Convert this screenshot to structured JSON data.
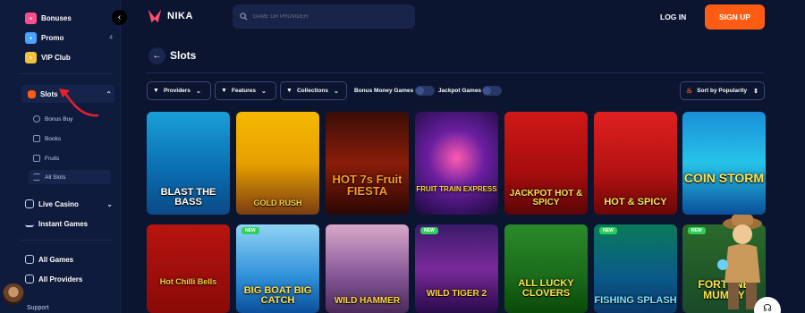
{
  "header": {
    "logo_text": "NIKA",
    "search_placeholder": "GAME OR PROVIDER",
    "login_label": "LOG IN",
    "signup_label": "SIGN UP"
  },
  "sidebar": {
    "items": [
      {
        "label": "Bonuses",
        "icon": "gift-icon"
      },
      {
        "label": "Promo",
        "count": "4",
        "icon": "promo-icon"
      },
      {
        "label": "VIP Club",
        "icon": "crown-icon"
      }
    ],
    "slots_label": "Slots",
    "sub_items": [
      {
        "label": "Bonus Buy",
        "icon": "coin-icon"
      },
      {
        "label": "Books",
        "icon": "book-icon"
      },
      {
        "label": "Fruits",
        "icon": "fruit-icon"
      },
      {
        "label": "All Slots",
        "icon": "list-icon"
      }
    ],
    "live_casino_label": "Live Casino",
    "instant_games_label": "Instant Games",
    "all_games_label": "All Games",
    "all_providers_label": "All Providers",
    "support_label": "Support"
  },
  "page": {
    "title": "Slots"
  },
  "filters": {
    "providers_label": "Providers",
    "features_label": "Features",
    "collections_label": "Collections",
    "bonus_money_label": "Bonus Money Games",
    "jackpot_label": "Jackpot Games",
    "sort_label": "Sort by Popularity"
  },
  "games": [
    {
      "title": "BLAST THE BASS",
      "new": false
    },
    {
      "title": "GOLD RUSH",
      "new": false
    },
    {
      "title": "HOT 7s Fruit FIESTA",
      "new": false
    },
    {
      "title": "FRUIT TRAIN EXPRESS",
      "new": false
    },
    {
      "title": "JACKPOT HOT & SPICY",
      "new": false
    },
    {
      "title": "HOT & SPICY",
      "new": false
    },
    {
      "title": "COIN STORM",
      "new": false
    },
    {
      "title": "Hot Chilli Bells",
      "new": false
    },
    {
      "title": "BIG BOAT BIG CATCH",
      "new": true
    },
    {
      "title": "WILD HAMMER",
      "new": false
    },
    {
      "title": "WILD TIGER 2",
      "new": true
    },
    {
      "title": "ALL LUCKY CLOVERS",
      "new": false
    },
    {
      "title": "FISHING SPLASH",
      "new": true
    },
    {
      "title": "FORTUNE MUMMY",
      "new": true
    }
  ],
  "new_badge_label": "NEW",
  "colors": {
    "accent": "#ff5b12",
    "background": "#0b1530",
    "sidebar": "#0f1b3d",
    "new_badge": "#2fcf5a"
  }
}
